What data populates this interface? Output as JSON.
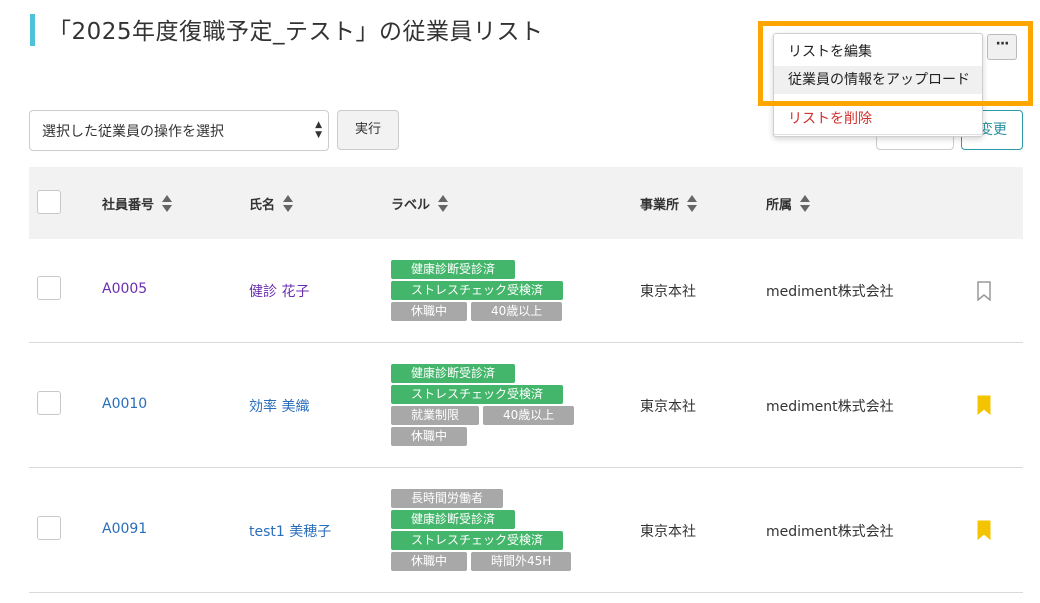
{
  "header": {
    "title": "「2025年度復職予定_テスト」の従業員リスト"
  },
  "toolbar": {
    "bulk_action_placeholder": "選択した従業員の操作を選択",
    "execute_label": "実行",
    "change_label": "変更",
    "more_label": "···"
  },
  "menu": {
    "items": [
      {
        "label": "リストを編集"
      },
      {
        "label": "従業員の情報をアップロード"
      },
      {
        "label": "リストを削除"
      }
    ]
  },
  "table": {
    "columns": [
      {
        "label": "社員番号"
      },
      {
        "label": "氏名"
      },
      {
        "label": "ラベル"
      },
      {
        "label": "事業所"
      },
      {
        "label": "所属"
      }
    ],
    "rows": [
      {
        "employee_id": "A0005",
        "name": "健診 花子",
        "labels": [
          [
            {
              "text": "健康診断受診済",
              "color": "green"
            }
          ],
          [
            {
              "text": "ストレスチェック受検済",
              "color": "green"
            }
          ],
          [
            {
              "text": "休職中",
              "color": "gray"
            },
            {
              "text": "40歳以上",
              "color": "gray"
            }
          ]
        ],
        "office": "東京本社",
        "department": "mediment株式会社",
        "bookmarked": false
      },
      {
        "employee_id": "A0010",
        "name": "効率 美織",
        "labels": [
          [
            {
              "text": "健康診断受診済",
              "color": "green"
            }
          ],
          [
            {
              "text": "ストレスチェック受検済",
              "color": "green"
            }
          ],
          [
            {
              "text": "就業制限",
              "color": "gray"
            },
            {
              "text": "40歳以上",
              "color": "gray"
            }
          ],
          [
            {
              "text": "休職中",
              "color": "gray"
            }
          ]
        ],
        "office": "東京本社",
        "department": "mediment株式会社",
        "bookmarked": true
      },
      {
        "employee_id": "A0091",
        "name": "test1 美穂子",
        "labels": [
          [
            {
              "text": "長時間労働者",
              "color": "gray"
            }
          ],
          [
            {
              "text": "健康診断受診済",
              "color": "green"
            }
          ],
          [
            {
              "text": "ストレスチェック受検済",
              "color": "green"
            }
          ],
          [
            {
              "text": "休職中",
              "color": "gray"
            },
            {
              "text": "時間外45H",
              "color": "gray"
            }
          ]
        ],
        "office": "東京本社",
        "department": "mediment株式会社",
        "bookmarked": true
      }
    ]
  },
  "colors": {
    "accent": "#4fc1d9",
    "tag_green": "#44b66b",
    "tag_gray": "#a8a8a8",
    "bookmark_active": "#f5c400",
    "highlight": "#ffa500",
    "danger": "#d0312d"
  }
}
